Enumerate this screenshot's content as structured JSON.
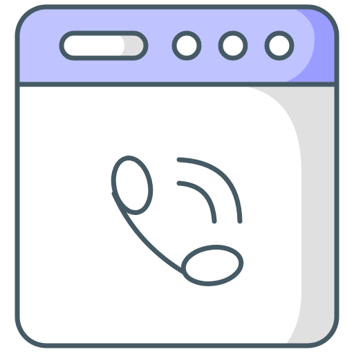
{
  "icon": {
    "name": "browser-phone-call-icon",
    "colors": {
      "outline": "#455a64",
      "header_fill": "#bfc3ff",
      "header_shadow": "#9a9cff",
      "body_fill": "#ffffff",
      "body_shadow": "#e0e0e0",
      "control_fill": "#ffffff",
      "control_shadow": "#e0e0e0"
    },
    "parts": [
      "window-frame",
      "title-bar",
      "address-pill",
      "window-dot-1",
      "window-dot-2",
      "window-dot-3",
      "phone-handset-icon",
      "signal-waves-icon"
    ]
  }
}
